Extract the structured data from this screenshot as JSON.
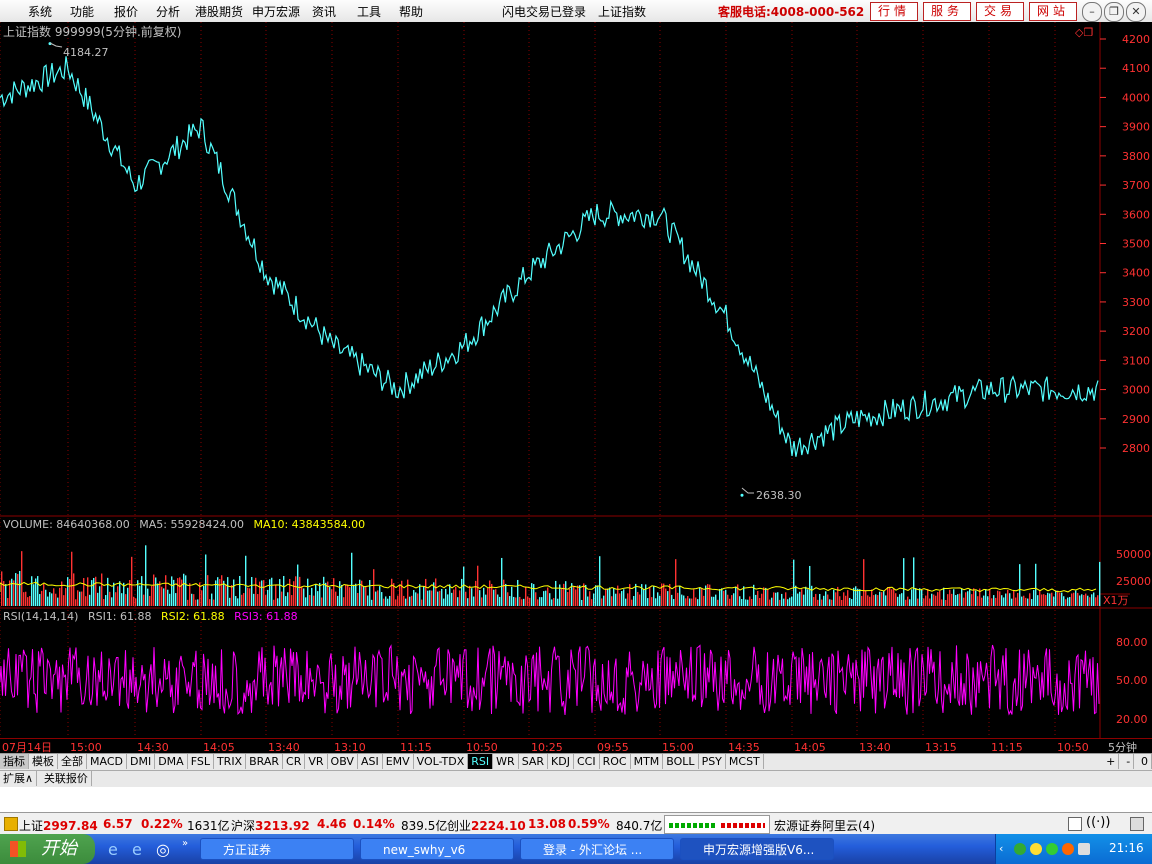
{
  "menu": {
    "items": [
      "系统",
      "功能",
      "报价",
      "分析",
      "港股期货",
      "申万宏源",
      "资讯",
      "工具",
      "帮助"
    ],
    "status_login": "闪电交易已登录",
    "current_index": "上证指数",
    "hotline": "客服电话:4008-000-562",
    "buttons": [
      "行情",
      "服务",
      "交易",
      "网站"
    ]
  },
  "chart": {
    "title": "上证指数 999999(5分钟.前复权)",
    "high_label": "4184.27",
    "low_label": "2638.30",
    "price_ticks": [
      "4200",
      "4100",
      "4000",
      "3900",
      "3800",
      "3700",
      "3600",
      "3500",
      "3400",
      "3300",
      "3200",
      "3100",
      "3000",
      "2900",
      "2800"
    ],
    "volume_header": {
      "volume": "VOLUME: 84640368.00",
      "ma5": "MA5: 55928424.00",
      "ma10": "MA10: 43843584.00"
    },
    "volume_ticks": [
      "50000",
      "25000"
    ],
    "volume_unit": "X1万",
    "rsi_header": {
      "name": "RSI(14,14,14)",
      "rsi1": "RSI1: 61.88",
      "rsi2": "RSI2: 61.88",
      "rsi3": "RSI3: 61.88"
    },
    "rsi_ticks": [
      "80.00",
      "50.00",
      "20.00"
    ],
    "time_labels": [
      "07月14日",
      "15:00",
      "14:30",
      "14:05",
      "13:40",
      "13:10",
      "11:15",
      "10:50",
      "10:25",
      "09:55",
      "15:00",
      "14:35",
      "14:05",
      "13:40",
      "13:15",
      "11:15",
      "10:50"
    ],
    "period": "5分钟",
    "colors": {
      "up": "#ff3232",
      "down": "#54ffff",
      "rsi": "#ff00ff",
      "ma10": "#ffff00",
      "grid": "#8b0000"
    }
  },
  "chart_data": {
    "type": "line",
    "title": "上证指数 999999(5分钟.前复权)",
    "xlabel": "",
    "ylabel": "",
    "ylim": [
      2600,
      4250
    ],
    "x": [
      "07月14日",
      "15:00",
      "14:30",
      "14:05",
      "13:40",
      "13:10",
      "11:15",
      "10:50",
      "10:25",
      "09:55",
      "15:00",
      "14:35",
      "14:05",
      "13:40",
      "13:15",
      "11:15",
      "10:50"
    ],
    "series": [
      {
        "name": "上证指数",
        "values": [
          4000,
          4100,
          3700,
          3900,
          3400,
          3150,
          3000,
          3150,
          3400,
          3600,
          3600,
          3250,
          2800,
          2900,
          2950,
          3000,
          3000
        ]
      }
    ],
    "annotations": {
      "high": 4184.27,
      "low": 2638.3
    }
  },
  "tabs": {
    "indicators": [
      "指标",
      "模板",
      "全部",
      "MACD",
      "DMI",
      "DMA",
      "FSL",
      "TRIX",
      "BRAR",
      "CR",
      "VR",
      "OBV",
      "ASI",
      "EMV",
      "VOL-TDX",
      "RSI",
      "WR",
      "SAR",
      "KDJ",
      "CCI",
      "ROC",
      "MTM",
      "BOLL",
      "PSY",
      "MCST"
    ],
    "active_indicator": "RSI",
    "sub": [
      "扩展∧",
      "关联报价"
    ],
    "zoom": [
      "+",
      "-",
      "0"
    ]
  },
  "status": {
    "sh_label": "上证",
    "sh_value": "2997.84",
    "sh_change": "6.57",
    "sh_pct": "0.22%",
    "sh_amount": "1631亿",
    "hs_label": "沪深",
    "hs_value": "3213.92",
    "hs_change": "4.46",
    "hs_pct": "0.14%",
    "hs_amount": "839.5亿",
    "cy_label": "创业",
    "cy_value": "2224.10",
    "cy_change": "13.08",
    "cy_pct": "0.59%",
    "cy_amount": "840.7亿",
    "server": "宏源证券阿里云(4)"
  },
  "taskbar": {
    "start": "开始",
    "tasks": [
      "方正证券",
      "new_swhy_v6",
      "登录 - 外汇论坛 ...",
      "申万宏源增强版V6..."
    ],
    "clock": "21:16"
  }
}
